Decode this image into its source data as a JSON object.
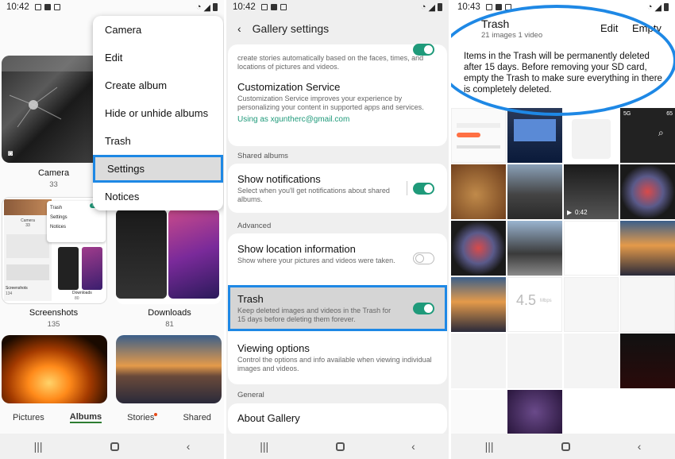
{
  "panel1": {
    "status_time": "10:42",
    "menu": [
      "Camera",
      "Edit",
      "Create album",
      "Hide or unhide albums",
      "Trash",
      "Settings",
      "Notices"
    ],
    "selected_menu": "Settings",
    "albums": [
      {
        "name": "Camera",
        "count": "33"
      },
      {
        "name": "Screenshots",
        "count": "135"
      },
      {
        "name": "Downloads",
        "count": "81"
      }
    ],
    "mini_menu": [
      "Trash",
      "Settings",
      "Notices"
    ],
    "mini_new_badge": "NEW",
    "mini_camera_title": "Camera",
    "mini_camera_count": "33",
    "mini_screenshots_label": "Screenshots",
    "mini_screenshots_count": "134",
    "mini_downloads_label": "Downloads",
    "mini_downloads_count": "80",
    "tabs": [
      "Pictures",
      "Albums",
      "Stories",
      "Shared"
    ],
    "active_tab": "Albums"
  },
  "panel2": {
    "status_time": "10:42",
    "title": "Gallery settings",
    "stories_desc_tail": "create stories automatically based on the faces, times, and locations of pictures and videos.",
    "customization": {
      "title": "Customization Service",
      "desc": "Customization Service improves your experience by personalizing your content in supported apps and services.",
      "account": "Using as xguntherc@gmail.com"
    },
    "section_shared": "Shared albums",
    "notifications": {
      "title": "Show notifications",
      "desc": "Select when you'll get notifications about shared albums.",
      "on": true
    },
    "section_advanced": "Advanced",
    "location": {
      "title": "Show location information",
      "desc": "Show where your pictures and videos were taken.",
      "on": false
    },
    "trash": {
      "title": "Trash",
      "desc": "Keep deleted images and videos in the Trash for 15 days before deleting them forever.",
      "on": true
    },
    "viewing": {
      "title": "Viewing options",
      "desc": "Control the options and info available when viewing individual images and videos."
    },
    "section_general": "General",
    "about": "About Gallery"
  },
  "panel3": {
    "status_time": "10:43",
    "title": "Trash",
    "subtitle": "21 images 1 video",
    "edit_label": "Edit",
    "empty_label": "Empty",
    "info": "Items in the Trash will be permanently deleted after 15 days. Before removing your SD card, empty the Trash to make sure everything in there is completely deleted.",
    "video_duration": "0:42",
    "speed_text": "4.5",
    "speed_unit": "Mbps",
    "status_5g": "5G",
    "status_battery": "65"
  },
  "colors": {
    "accent_blue": "#1e88e5",
    "toggle_green": "#1f9a7a",
    "link_green": "#1f9a7a"
  }
}
